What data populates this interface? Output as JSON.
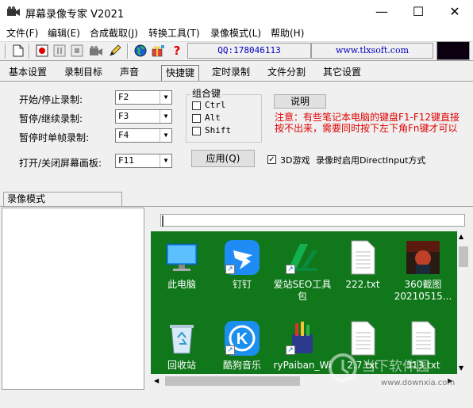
{
  "window": {
    "title": "屏幕录像专家 V2021",
    "minimize_glyph": "—",
    "maximize_glyph": "☐",
    "close_glyph": "✕"
  },
  "menu": [
    "文件(F)",
    "编辑(E)",
    "合成截取(J)",
    "转换工具(T)",
    "录像模式(L)",
    "帮助(H)"
  ],
  "toolbar": {
    "icons": [
      "new-file-icon",
      "record-icon",
      "pause-icon",
      "stop-icon",
      "camera-icon",
      "pencil-icon",
      "globe-icon",
      "gift-icon",
      "help-icon"
    ],
    "help_glyph": "?",
    "qq": "QQ:178046113",
    "website": "www.tlxsoft.com"
  },
  "tabs": [
    "基本设置",
    "录制目标",
    "声音",
    "快捷键",
    "定时录制",
    "文件分割",
    "其它设置"
  ],
  "active_tab": "快捷键",
  "hotkeys": {
    "rows": [
      {
        "label": "开始/停止录制:",
        "value": "F2"
      },
      {
        "label": "暂停/继续录制:",
        "value": "F3"
      },
      {
        "label": "暂停时单帧录制:",
        "value": "F4"
      },
      {
        "label": "打开/关闭屏幕画板:",
        "value": "F11"
      }
    ],
    "dropdown_glyph": "▼",
    "modifier_group_title": "组合键",
    "modifiers": [
      "Ctrl",
      "Alt",
      "Shift"
    ],
    "explain_button": "说明",
    "apply_button": "应用(Q)",
    "game_check_glyph": "✓",
    "game_mode_label": "3D游戏",
    "game_mode_desc": "录像时启用DirectInput方式",
    "note": "注意：有些笔记本电脑的键盘F1-F12键直接按不出来，需要同时按下左下角Fn键才可以"
  },
  "lower": {
    "section_tab": "录像模式",
    "scroll_up_glyph": "▲",
    "scroll_down_glyph": "▼",
    "scroll_left_glyph": "◀",
    "scroll_right_glyph": "▶"
  },
  "desktop": {
    "icons": [
      {
        "label": "此电脑",
        "icon": "computer-icon"
      },
      {
        "label": "钉钉",
        "icon": "dingtalk-icon"
      },
      {
        "label": "爱站SEO工具包",
        "icon": "aizhan-seo-icon"
      },
      {
        "label": "222.txt",
        "icon": "text-file-icon"
      },
      {
        "label": "360截图20210515...",
        "icon": "screenshot-thumbnail-icon"
      },
      {
        "label": "回收站",
        "icon": "recycle-bin-icon"
      },
      {
        "label": "酷狗音乐",
        "icon": "kugou-icon"
      },
      {
        "label": "ryPaiban_Wi",
        "icon": "ruipaiban-icon"
      },
      {
        "label": "2.7.txt",
        "icon": "text-file-icon"
      },
      {
        "label": "313.txt",
        "icon": "text-file-icon"
      }
    ],
    "kugou_letter": "K",
    "shortcut_arrow": "↗"
  },
  "watermark": {
    "brand": "当下软件园",
    "url": "www.downxia.com"
  },
  "colors": {
    "desktop_bg": "#10781b",
    "note_text": "#e00000",
    "link_text": "#0000c0"
  }
}
